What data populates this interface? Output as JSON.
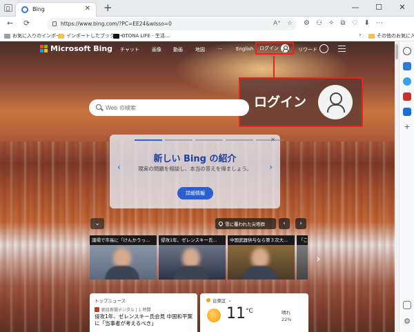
{
  "browser": {
    "tab_title": "Bing",
    "tab_close": "✕",
    "new_tab": "+",
    "win_min": "—",
    "win_max": "☐",
    "win_close": "✕",
    "back": "←",
    "refresh": "⟳",
    "url": "https://www.bing.com/?PC=EE24&wlsso=0",
    "url_icons": [
      "A⁺",
      "☆"
    ],
    "toolbar_icons": [
      "⚙",
      "⚇",
      "✧",
      "⧉",
      "♡",
      "⬇",
      "⋯"
    ],
    "bookmarks": [
      {
        "label": "お気に入りのインポート",
        "type": "import"
      },
      {
        "label": "インポートしたブックマー...",
        "type": "folder"
      },
      {
        "label": "OTONA LIFE - 生活...",
        "type": "site"
      }
    ],
    "bookmarks_overflow": "›",
    "other_favorites": "その他のお気に入り"
  },
  "bing": {
    "logo_text": "Microsoft Bing",
    "logo_colors": [
      "#f25022",
      "#7fba00",
      "#00a4ef",
      "#ffb900"
    ],
    "nav": [
      {
        "label": "チャット"
      },
      {
        "label": "画像"
      },
      {
        "label": "動画"
      },
      {
        "label": "地図"
      },
      {
        "label": "···"
      }
    ],
    "language": "English",
    "login_label": "ログイン",
    "rewards_label": "リワード",
    "trophy_glyph": "🏆",
    "callout_label": "ログイン",
    "search_placeholder": "Web の検索",
    "promo": {
      "title": "新しい Bing の紹介",
      "description": "現実の問題を相談し、本当の答えを得ましょう。",
      "button": "詳細情報",
      "close": "✕",
      "prev": "‹",
      "next": "›",
      "slides": 5,
      "active_slide": 1
    },
    "collapse_glyph": "⌄",
    "location_label": "雪に覆われた尖塔群",
    "img_prev": "‹",
    "img_next": "›",
    "news_cards": [
      {
        "title": "議場で市長に「けんかうっ..."
      },
      {
        "title": "侵攻1年、ゼレンスキー氏..."
      },
      {
        "title": "中国武器供与なら第３次大..."
      },
      {
        "title": "「こ"
      }
    ],
    "strip_next": "›",
    "top_news": {
      "label": "トップニュース",
      "source": "朝日新聞デジタル | 1 時間",
      "headline": "侵攻1年、ゼレンスキー氏会見 中国和平案に「当事者が考えるべき」"
    },
    "weather": {
      "location": "台東区",
      "temp": "11",
      "unit": "°C",
      "condition": "晴れ",
      "precip": "22%"
    }
  }
}
